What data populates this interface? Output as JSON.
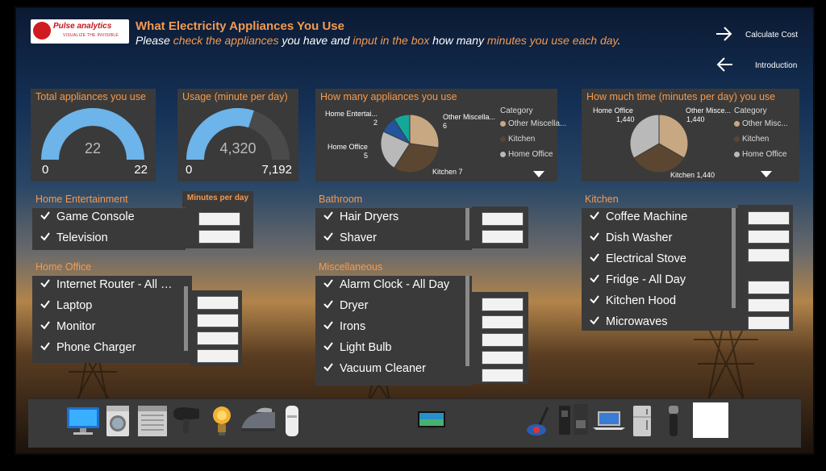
{
  "header": {
    "logo_text": "Pulse analytics",
    "logo_tagline": "VISUALIZE THE INVISIBLE",
    "title": "What Electricity Appliances You Use",
    "subtitle_parts": [
      "Please ",
      "check the appliances",
      " you have and ",
      "input in the box",
      " how many ",
      "minutes you use each day",
      "."
    ]
  },
  "nav": {
    "next_label": "Calculate Cost",
    "back_label": "Introduction"
  },
  "cards": {
    "total": {
      "title": "Total appliances you use",
      "value": "22",
      "min": "0",
      "max": "22",
      "fraction": 1.0,
      "color": "#6cb4ea"
    },
    "usage": {
      "title": "Usage (minute per day)",
      "value": "4,320",
      "min": "0",
      "max": "7,192",
      "fraction": 0.6007,
      "color": "#6cb4ea"
    }
  },
  "pie_count": {
    "title": "How many appliances you use",
    "legend_title": "Category",
    "legend": [
      "Other Miscella...",
      "Kitchen",
      "Home Office"
    ],
    "labels": {
      "home_ent": "Home Entertai...",
      "home_ent_value": "2",
      "other": "Other Miscella...",
      "other_value": "6",
      "home_office": "Home Office",
      "home_office_value": "5",
      "kitchen": "Kitchen 7"
    }
  },
  "pie_time": {
    "title": "How much time (minutes per day) you use",
    "legend_title": "Category",
    "legend": [
      "Other Misc...",
      "Kitchen",
      "Home Office"
    ],
    "labels": {
      "home_office": "Home Office",
      "home_office_value": "1,440",
      "other": "Other Misce...",
      "other_value": "1,440",
      "kitchen": "Kitchen 1,440"
    }
  },
  "chart_data": [
    {
      "type": "pie",
      "title": "How many appliances you use",
      "categories": [
        "Other Miscella...",
        "Kitchen",
        "Home Office",
        "Home Entertai...",
        "Bathroom"
      ],
      "values": [
        6,
        7,
        5,
        2,
        2
      ],
      "colors": [
        "#c8a882",
        "#5b4631",
        "#b9b9b9",
        "#23549d",
        "#15a89a"
      ],
      "legend_position": "right"
    },
    {
      "type": "pie",
      "title": "How much time (minutes per day) you use",
      "categories": [
        "Other Misce...",
        "Kitchen",
        "Home Office"
      ],
      "values": [
        1440,
        1440,
        1440
      ],
      "colors": [
        "#c8a882",
        "#5b4631",
        "#b9b9b9"
      ],
      "legend_position": "right"
    }
  ],
  "minutes_per_day_label": "Minutes per day",
  "sections": {
    "home_entertainment": {
      "title": "Home Entertainment",
      "items": [
        "Game Console",
        "Television"
      ]
    },
    "bathroom": {
      "title": "Bathroom",
      "items": [
        "Hair Dryers",
        "Shaver"
      ]
    },
    "kitchen": {
      "title": "Kitchen",
      "items": [
        "Coffee Machine",
        "Dish Washer",
        "Electrical Stove",
        "Fridge - All Day",
        "Kitchen Hood",
        "Microwaves"
      ]
    },
    "home_office": {
      "title": "Home Office",
      "items": [
        "Internet Router - All …",
        "Laptop",
        "Monitor",
        "Phone Charger"
      ]
    },
    "misc": {
      "title": "Miscellaneous",
      "items": [
        "Alarm Clock - All Day",
        "Dryer",
        "Irons",
        "Light Bulb",
        "Vacuum Cleaner"
      ]
    }
  },
  "footer_icons": [
    "computer-icon",
    "washing-machine-icon",
    "dishwasher-icon",
    "hair-dryer-icon",
    "light-bulb-icon",
    "iron-icon",
    "water-heater-icon",
    "television-icon",
    "vacuum-cleaner-icon",
    "coffee-machine-icon",
    "laptop-icon",
    "fridge-icon",
    "shaver-icon",
    "microwave-icon"
  ]
}
